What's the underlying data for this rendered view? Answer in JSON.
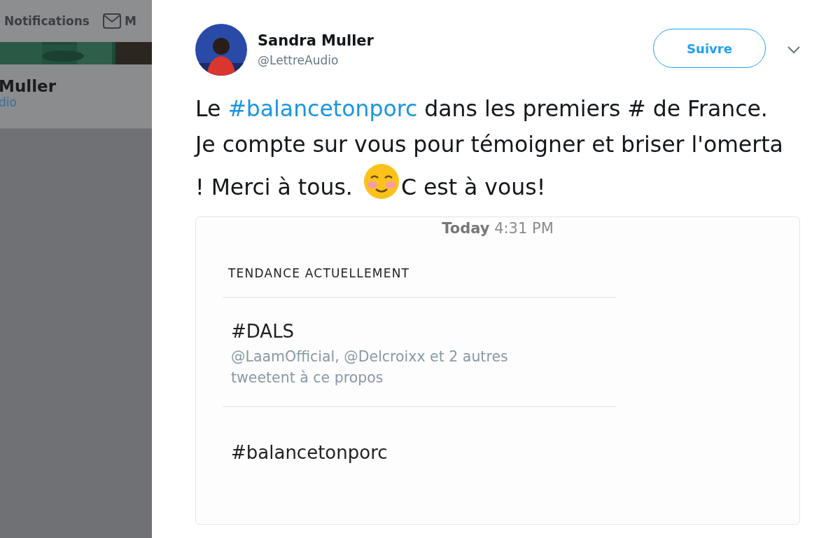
{
  "background_page": {
    "nav_label": "Notifications",
    "nav_cut": "M",
    "name_cut": "Muller",
    "handle_cut": "dio"
  },
  "tweet": {
    "author": "Sandra Muller",
    "handle": "@LettreAudio",
    "follow_button": "Suivre",
    "text_before": "Le ",
    "hashtag": "#balancetonporc",
    "text_after": " dans les premiers # de France.  Je compte sur vous pour témoigner et briser l'omerta ! Merci à tous. ",
    "text_end": "C est à vous!",
    "screenshot": {
      "timestamp": "**Today** 4:31 PM",
      "heading": "TENDANCE ACTUELLEMENT",
      "trends": [
        {
          "tag": "#DALS",
          "detail": "@LaamOfficial, @Delcroixx et 2 autres tweetent à ce propos"
        },
        {
          "tag": "#balancetonporc"
        }
      ]
    }
  }
}
